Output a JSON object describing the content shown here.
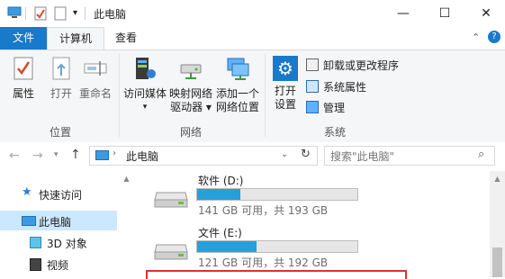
{
  "window": {
    "title": "此电脑",
    "minimize": "—",
    "maximize": "☐",
    "close": "✕"
  },
  "tabs": [
    {
      "label": "文件"
    },
    {
      "label": "计算机"
    },
    {
      "label": "查看"
    }
  ],
  "ribbon": {
    "location": {
      "group": "位置",
      "items": [
        {
          "label": "属性"
        },
        {
          "label": "打开"
        },
        {
          "label": "重命名"
        }
      ]
    },
    "network": {
      "group": "网络",
      "items": [
        {
          "label1": "访问媒体",
          "label2": "▾"
        },
        {
          "label1": "映射网络",
          "label2": "驱动器 ▾"
        },
        {
          "label1": "添加一个",
          "label2": "网络位置"
        }
      ]
    },
    "system": {
      "group": "系统",
      "open1": "打开",
      "open2": "设置",
      "items": [
        {
          "label": "卸载或更改程序"
        },
        {
          "label": "系统属性"
        },
        {
          "label": "管理"
        }
      ]
    }
  },
  "address": {
    "path": "此电脑",
    "search_placeholder": "搜索\"此电脑\""
  },
  "nav": [
    {
      "label": "快速访问"
    },
    {
      "label": "此电脑"
    },
    {
      "label": "3D 对象"
    },
    {
      "label": "视频"
    }
  ],
  "drives": [
    {
      "name": "软件 (D:)",
      "usage": "141 GB 可用，共 193 GB",
      "fill_fraction": 0.27
    },
    {
      "name": "文件 (E:)",
      "usage": "121 GB 可用，共 192 GB",
      "fill_fraction": 0.37
    }
  ],
  "colors": {
    "accent": "#1979ca",
    "bar_fill": "#26a0da",
    "selection": "#cce8ff"
  }
}
